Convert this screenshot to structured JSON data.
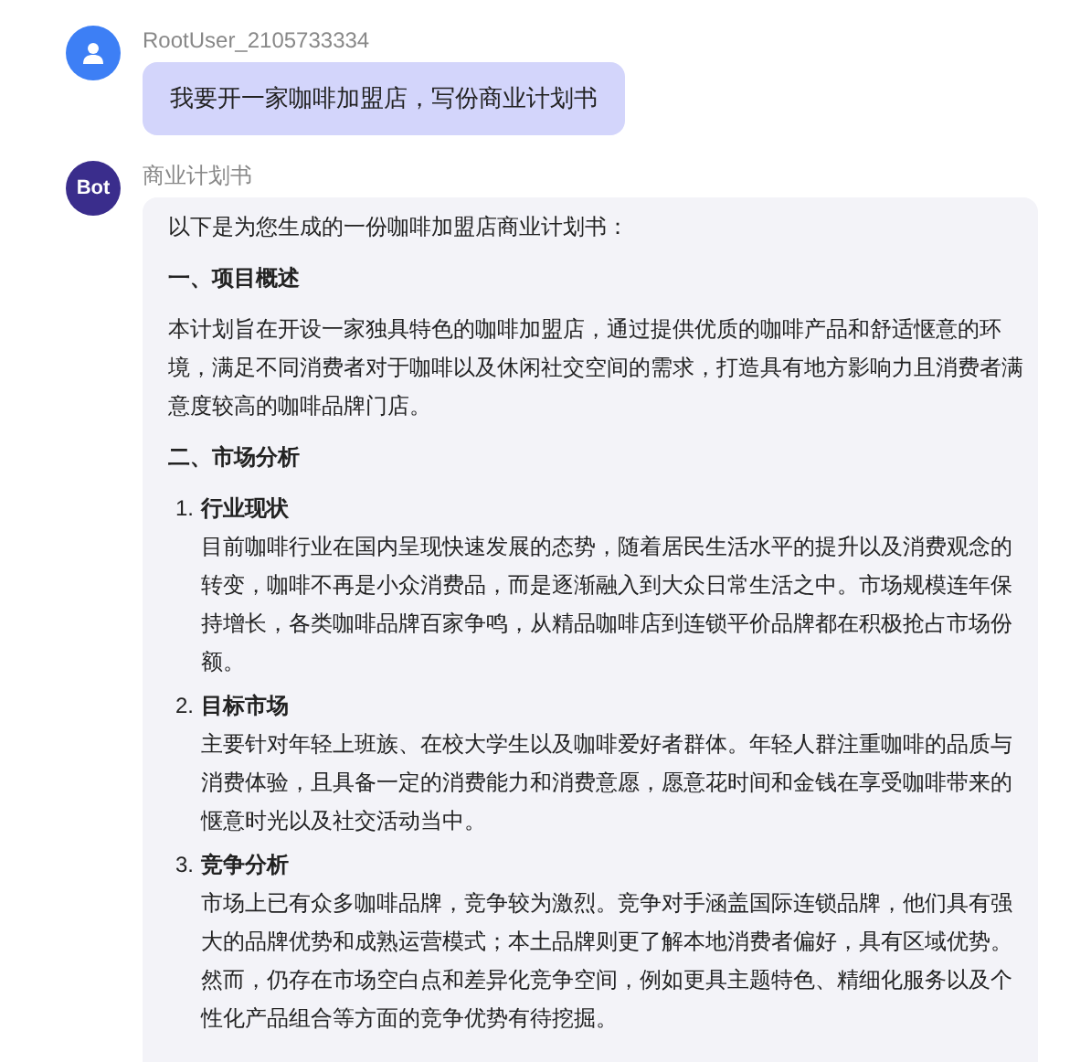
{
  "messages": [
    {
      "kind": "user",
      "author": "RootUser_2105733334",
      "text": "我要开一家咖啡加盟店，写份商业计划书"
    },
    {
      "kind": "bot",
      "avatar_label": "Bot",
      "author": "商业计划书",
      "blocks": [
        {
          "kind": "paragraph",
          "text": "以下是为您生成的一份咖啡加盟店商业计划书："
        },
        {
          "kind": "heading",
          "text": "一、项目概述"
        },
        {
          "kind": "paragraph",
          "text": "本计划旨在开设一家独具特色的咖啡加盟店，通过提供优质的咖啡产品和舒适惬意的环境，满足不同消费者对于咖啡以及休闲社交空间的需求，打造具有地方影响力且消费者满意度较高的咖啡品牌门店。"
        },
        {
          "kind": "heading",
          "text": "二、市场分析"
        },
        {
          "kind": "list",
          "items": [
            {
              "number": "1.",
              "title": "行业现状",
              "text": "目前咖啡行业在国内呈现快速发展的态势，随着居民生活水平的提升以及消费观念的转变，咖啡不再是小众消费品，而是逐渐融入到大众日常生活之中。市场规模连年保持增长，各类咖啡品牌百家争鸣，从精品咖啡店到连锁平价品牌都在积极抢占市场份额。"
            },
            {
              "number": "2.",
              "title": "目标市场",
              "text": "主要针对年轻上班族、在校大学生以及咖啡爱好者群体。年轻人群注重咖啡的品质与消费体验，且具备一定的消费能力和消费意愿，愿意花时间和金钱在享受咖啡带来的惬意时光以及社交活动当中。"
            },
            {
              "number": "3.",
              "title": "竞争分析",
              "text": "市场上已有众多咖啡品牌，竞争较为激烈。竞争对手涵盖国际连锁品牌，他们具有强大的品牌优势和成熟运营模式；本土品牌则更了解本地消费者偏好，具有区域优势。然而，仍存在市场空白点和差异化竞争空间，例如更具主题特色、精细化服务以及个性化产品组合等方面的竞争优势有待挖掘。"
            }
          ]
        }
      ]
    }
  ]
}
